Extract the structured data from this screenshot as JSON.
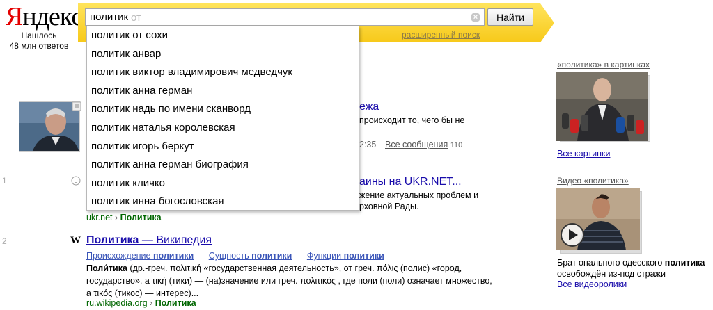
{
  "logo": {
    "ya": "Я",
    "rest": "ндекс"
  },
  "found": {
    "line1": "Нашлось",
    "line2": "48 млн ответов"
  },
  "search": {
    "query": "политик",
    "hint": "от"
  },
  "find_button": "Найти",
  "advanced_link": "расширенный поиск",
  "suggestions": [
    "политик от сохи",
    "политик анвар",
    "политик виктор владимирович медведчук",
    "политик анна герман",
    "политик надь по имени сканворд",
    "политик наталья королевская",
    "политик игорь беркут",
    "политик анна герман биография",
    "политик кличко",
    "политик инна богословская"
  ],
  "results": {
    "blogs": {
      "title_tail": "ежа",
      "snippet_tail": "происходит то, чего бы не",
      "time_tail": "2:35",
      "all_messages": "Все сообщения",
      "count": "110"
    },
    "r1": {
      "num": "1",
      "title_tail": "аины на UKR.NET...",
      "snip1": "жение актуальных проблем и",
      "snip2": "рховной Рады.",
      "url_host": "ukr.net",
      "url_sep": "›",
      "url_path": "Политика"
    },
    "r2": {
      "num": "2",
      "title_bold": "Политика",
      "title_rest": " — Википедия",
      "sub1_pre": "Происхождение ",
      "sub1_bold": "политики",
      "sub2_pre": "Сущность ",
      "sub2_bold": "политики",
      "sub3_pre": "Функции ",
      "sub3_bold": "политики",
      "snip_bold": "Поли́тика",
      "snip_l1": " (др.-греч. πολιτική «государственная деятельность», от греч. πόλις (полис) «город,",
      "snip_l2": "государство», а τική (тики) — (на)значение или греч. πολιτικός , где поли (поли) означает множество,",
      "snip_l3": "а τικός (тикос) — интерес)...",
      "url_host": "ru.wikipedia.org",
      "url_sep": "›",
      "url_path": "Политика"
    }
  },
  "right": {
    "images_head": "«политика» в картинках",
    "images_all": "Все картинки",
    "video_head": "Видео «политика»",
    "video_cap_pre": "Брат опального одесского ",
    "video_cap_bold": "политика",
    "video_cap_l2": "освобождён из-под стражи",
    "video_all": "Все видеоролики"
  },
  "colors": {
    "accent_yellow": "#fcd736",
    "logo_red": "#e40000",
    "link_blue": "#1a0dab",
    "url_green": "#006600"
  }
}
